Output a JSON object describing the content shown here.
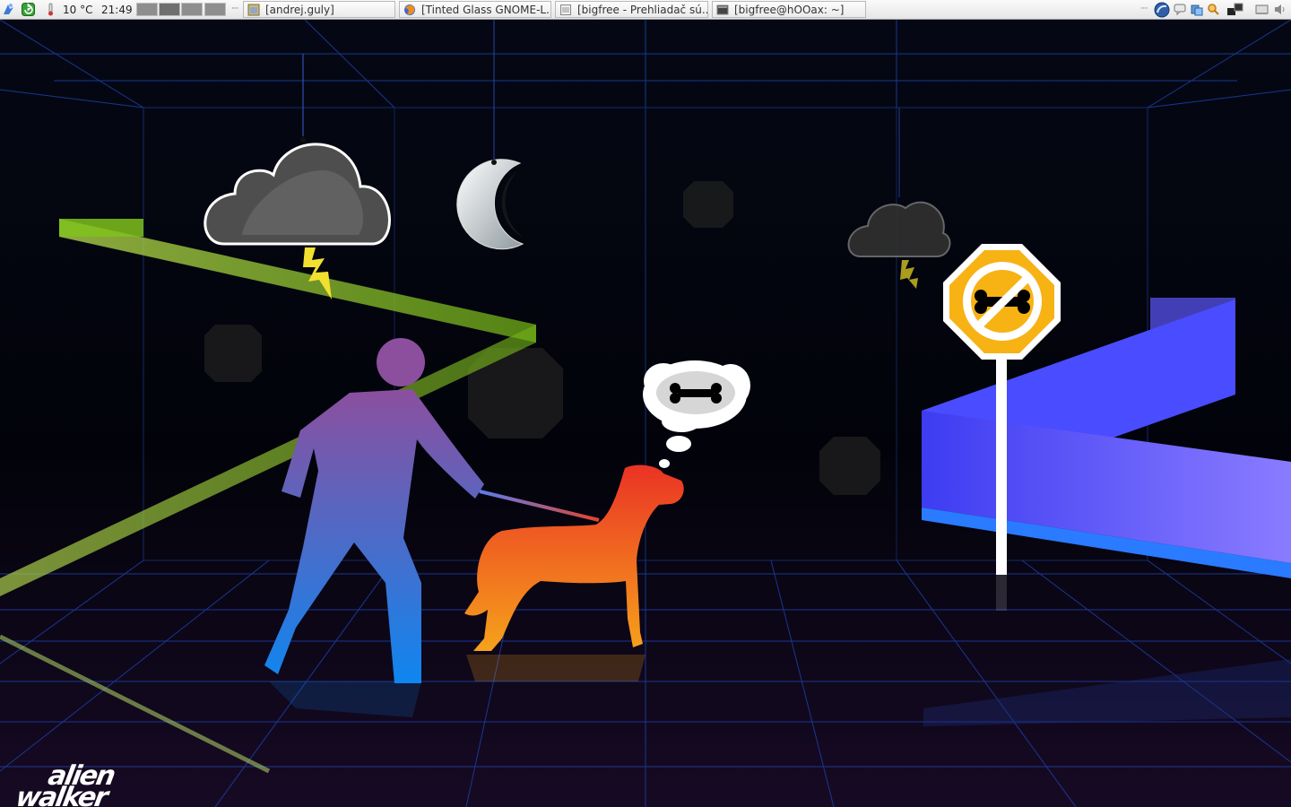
{
  "panel": {
    "weather": "10 °C",
    "clock": "21:49",
    "tasks": [
      {
        "label": "[andrej.guly]",
        "icon": "folder-icon"
      },
      {
        "label": "[Tinted Glass GNOME-L...",
        "icon": "firefox-icon"
      },
      {
        "label": "[bigfree - Prehliadač sú...",
        "icon": "file-browser-icon"
      },
      {
        "label": "[bigfree@hOOax: ~]",
        "icon": "terminal-icon"
      }
    ],
    "workspaces": 4,
    "active_workspace": 2
  },
  "wallpaper": {
    "signature_line1": "alien",
    "signature_line2": "walker",
    "colors": {
      "grid": "#2a55d6",
      "green_ribbon": "#8ccf1e",
      "blue_ribbon": "#4a55ff",
      "sign": "#f7b214",
      "cloud": "#555555"
    }
  }
}
